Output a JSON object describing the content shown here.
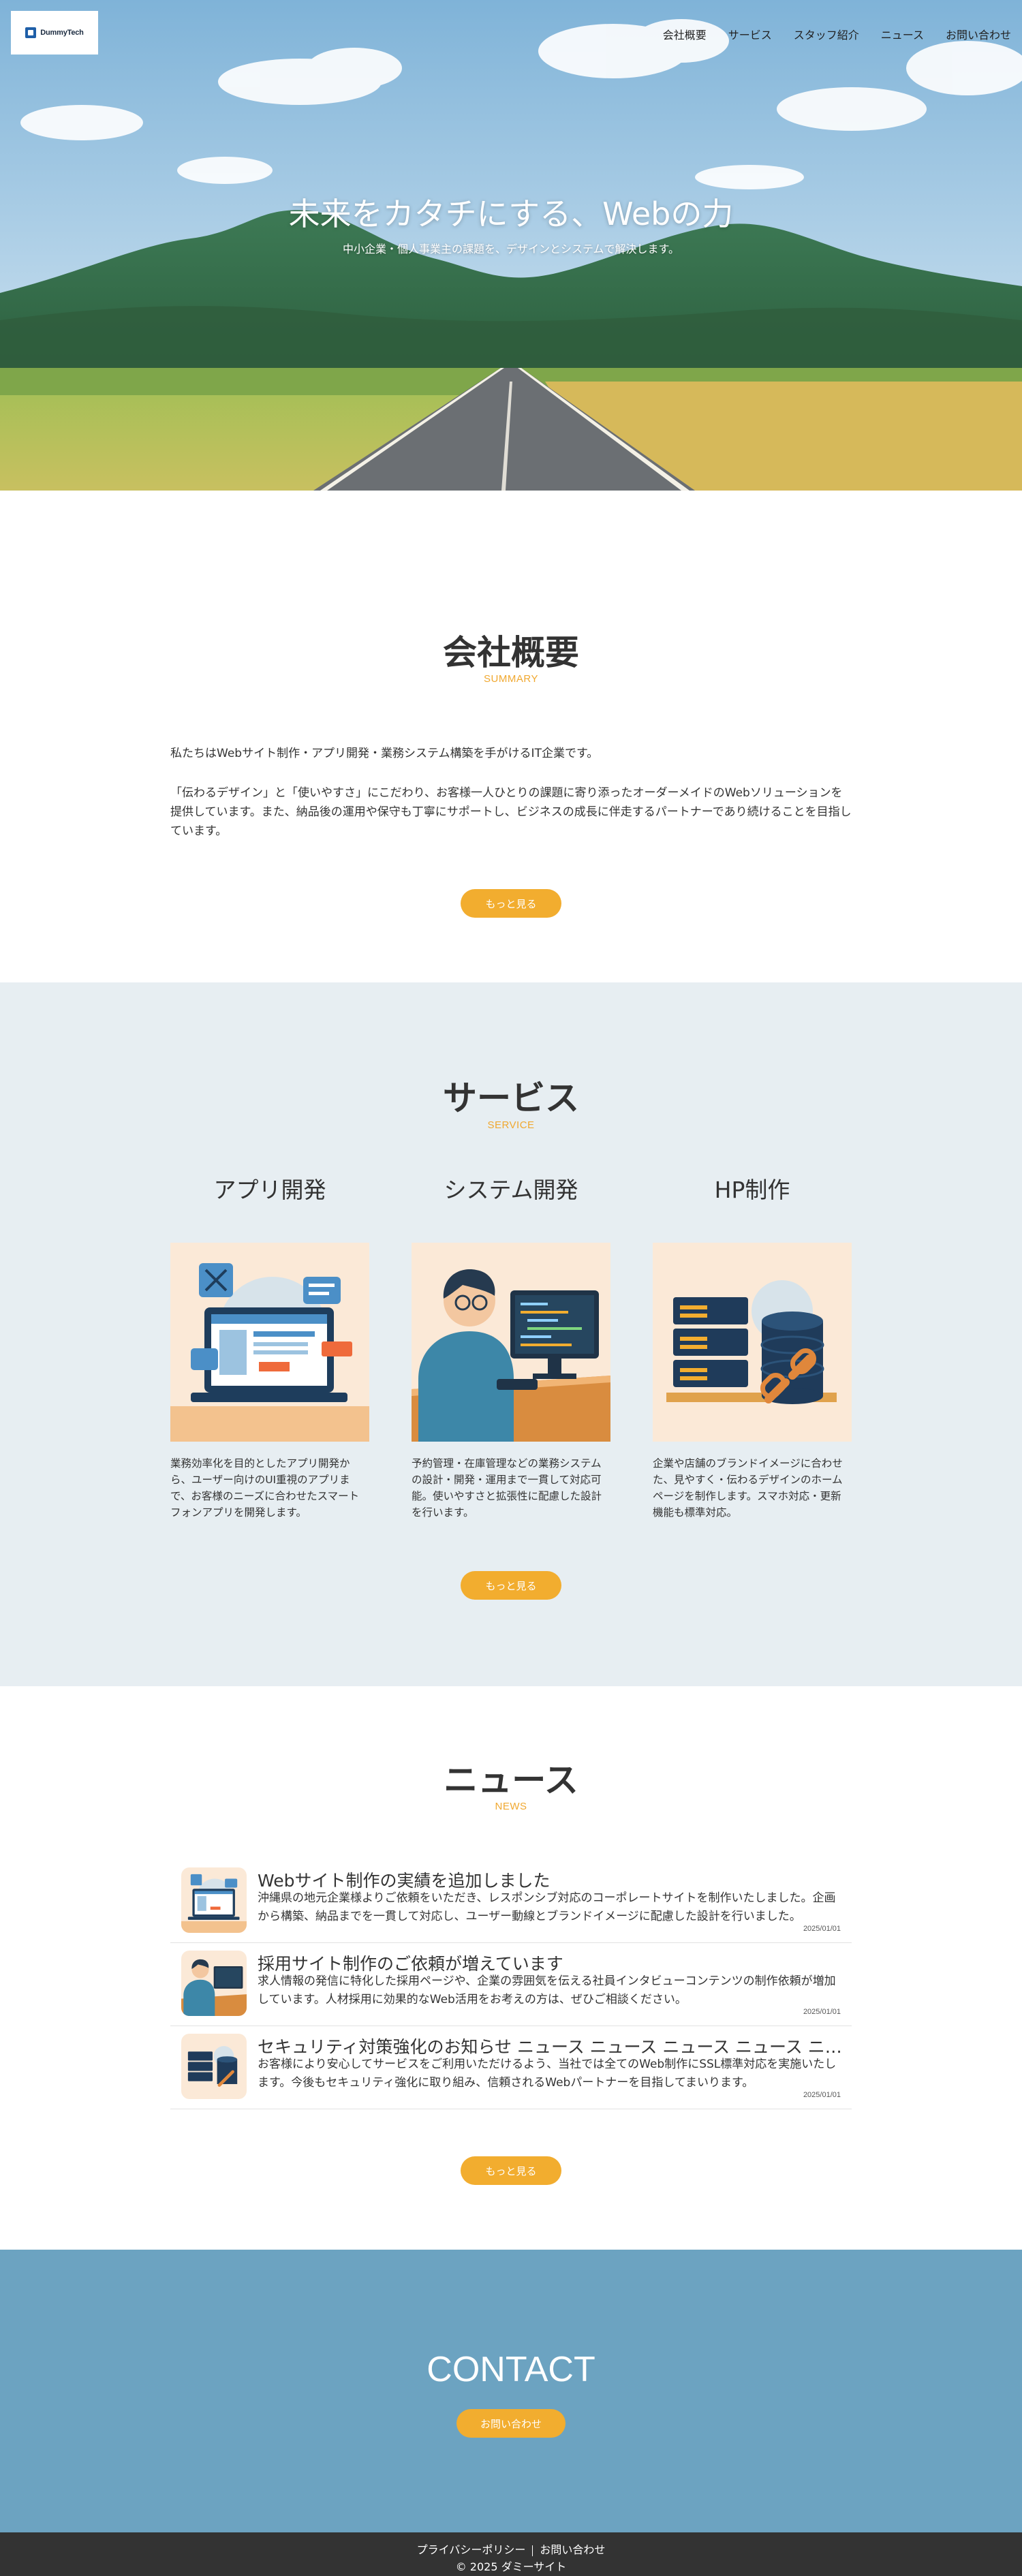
{
  "header": {
    "logo_text": "DummyTech",
    "nav": [
      "会社概要",
      "サービス",
      "スタッフ紹介",
      "ニュース",
      "お問い合わせ"
    ]
  },
  "hero": {
    "title": "未来をカタチにする、Webの力",
    "subtitle": "中小企業・個人事業主の課題を、デザインとシステムで解決します。"
  },
  "summary": {
    "title": "会社概要",
    "subtitle": "SUMMARY",
    "paragraphs": [
      "私たちはWebサイト制作・アプリ開発・業務システム構築を手がけるIT企業です。",
      "「伝わるデザイン」と「使いやすさ」にこだわり、お客様一人ひとりの課題に寄り添ったオーダーメイドのWebソリューションを提供しています。また、納品後の運用や保守も丁寧にサポートし、ビジネスの成長に伴走するパートナーであり続けることを目指しています。"
    ],
    "button": "もっと見る"
  },
  "service": {
    "title": "サービス",
    "subtitle": "SERVICE",
    "items": [
      {
        "name": "アプリ開発",
        "icon": "app-development-illustration",
        "desc": "業務効率化を目的としたアプリ開発から、ユーザー向けのUI重視のアプリまで、お客様のニーズに合わせたスマートフォンアプリを開発します。"
      },
      {
        "name": "システム開発",
        "icon": "system-development-illustration",
        "desc": "予約管理・在庫管理などの業務システムの設計・開発・運用まで一貫して対応可能。使いやすさと拡張性に配慮した設計を行います。"
      },
      {
        "name": "HP制作",
        "icon": "website-production-illustration",
        "desc": "企業や店舗のブランドイメージに合わせた、見やすく・伝わるデザインのホームページを制作します。スマホ対応・更新機能も標準対応。"
      }
    ],
    "button": "もっと見る"
  },
  "news": {
    "title": "ニュース",
    "subtitle": "NEWS",
    "items": [
      {
        "title": "Webサイト制作の実績を追加しました",
        "body": "沖縄県の地元企業様よりご依頼をいただき、レスポンシブ対応のコーポレートサイトを制作いたしました。企画から構築、納品までを一貫して対応し、ユーザー動線とブランドイメージに配慮した設計を行いました。",
        "date": "2025/01/01",
        "icon": "app-development-illustration"
      },
      {
        "title": "採用サイト制作のご依頼が増えています",
        "body": "求人情報の発信に特化した採用ページや、企業の雰囲気を伝える社員インタビューコンテンツの制作依頼が増加しています。人材採用に効果的なWeb活用をお考えの方は、ぜひご相談ください。",
        "date": "2025/01/01",
        "icon": "system-development-illustration"
      },
      {
        "title": "セキュリティ対策強化のお知らせ ニュース ニュース ニュース ニュース ニュース",
        "body": "お客様により安心してサービスをご利用いただけるよう、当社では全てのWeb制作にSSL標準対応を実施いたします。今後もセキュリティ強化に取り組み、信頼されるWebパートナーを目指してまいります。",
        "date": "2025/01/01",
        "icon": "website-production-illustration"
      }
    ],
    "button": "もっと見る"
  },
  "contact": {
    "title": "CONTACT",
    "button": "お問い合わせ"
  },
  "footer": {
    "links": [
      "プライバシーポリシー",
      "お問い合わせ"
    ],
    "copyright": "© 2025 ダミーサイト"
  },
  "colors": {
    "accent": "#f2ad2f",
    "service_bg": "#e7eef2",
    "contact_bg": "#6ca3c1",
    "footer_bg": "#333333"
  }
}
